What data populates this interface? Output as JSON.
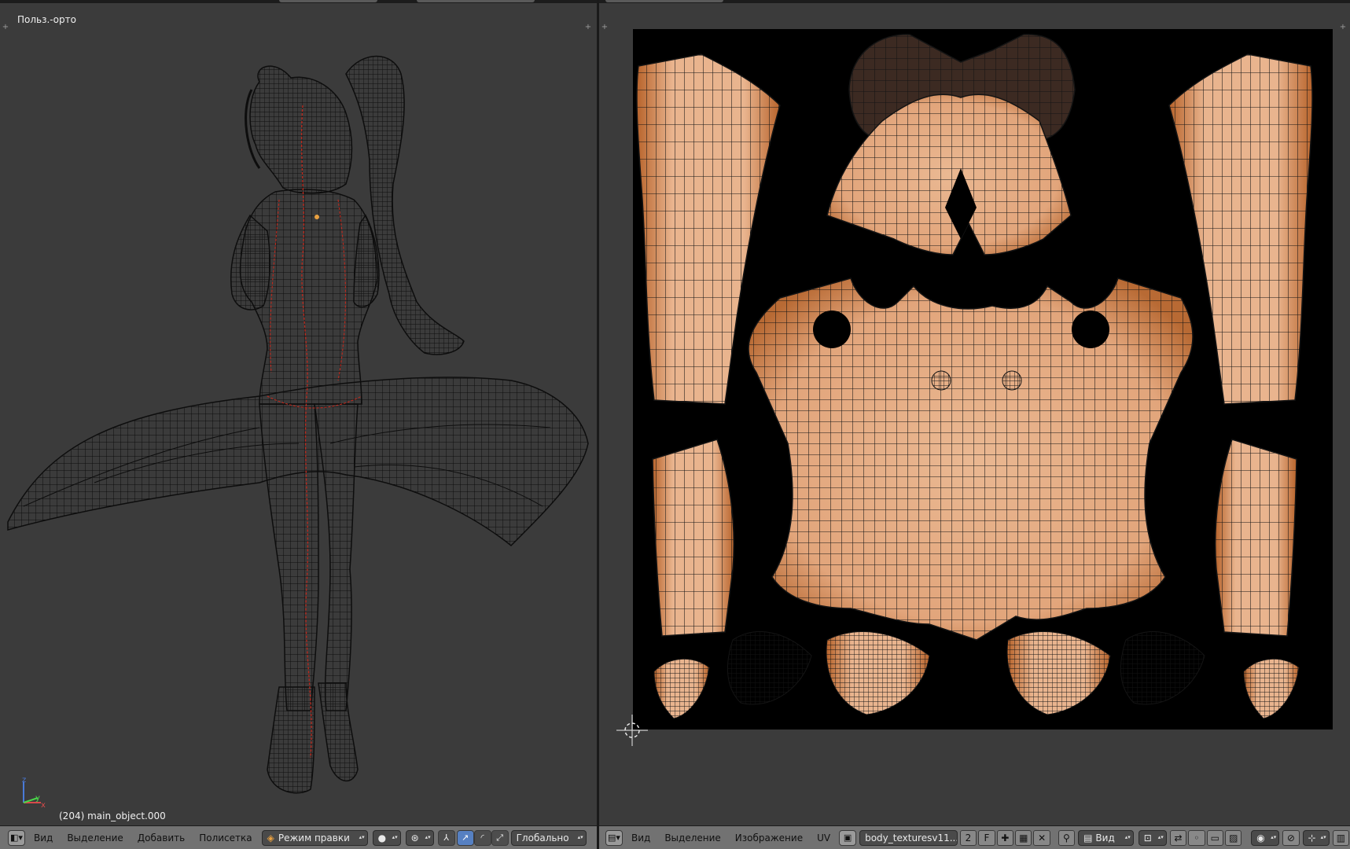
{
  "viewport3d": {
    "view_label": "Польз.-орто",
    "object_label": "(204) main_object.000",
    "axes": {
      "x": "x",
      "y": "y",
      "z": "z"
    }
  },
  "header3d": {
    "menus": [
      "Вид",
      "Выделение",
      "Добавить",
      "Полисетка"
    ],
    "mode": "Режим правки",
    "orientation": "Глобально"
  },
  "uv_editor": {
    "menus": [
      "Вид",
      "Выделение",
      "Изображение",
      "UV"
    ],
    "image_name": "body_texturesv11....",
    "users": "2",
    "fake_user": "F",
    "view_dropdown": "Вид"
  },
  "colors": {
    "skin_light": "#e9b48e",
    "skin_dark": "#b8642c",
    "hair": "#3c2a22",
    "wire": "#101010",
    "seam": "#c0281c",
    "panel": "#3b3b3b",
    "header": "#727272",
    "accent": "#5680c2"
  },
  "icons": {
    "editor_type": "cube-icon",
    "pivot": "pivot-icon",
    "manipulator": "manipulator-icon",
    "cursor": "cursor-icon"
  }
}
